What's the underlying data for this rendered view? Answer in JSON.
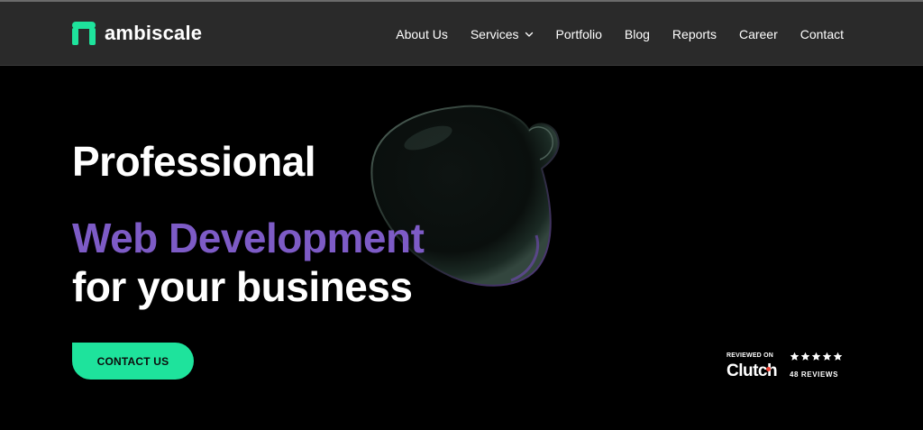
{
  "brand": {
    "name": "ambiscale",
    "logo_icon": "ambiscale-logo-mark",
    "accent_color": "#1ee39c"
  },
  "nav": {
    "items": [
      {
        "label": "About Us"
      },
      {
        "label": "Services",
        "has_dropdown": true
      },
      {
        "label": "Portfolio"
      },
      {
        "label": "Blog"
      },
      {
        "label": "Reports"
      },
      {
        "label": "Career"
      },
      {
        "label": "Contact"
      }
    ]
  },
  "hero": {
    "line1": "Professional",
    "line2": "Web Development",
    "line3": "for your business",
    "highlight_color": "#7d5bc6",
    "cta_label": "CONTACT US",
    "cta_color": "#1ee39c",
    "decor": "glass-blob"
  },
  "clutch": {
    "reviewed_on": "REVIEWED ON",
    "brand": "Clutch",
    "rating": 5,
    "rating_max": 5,
    "reviews": "48  REVIEWS"
  }
}
